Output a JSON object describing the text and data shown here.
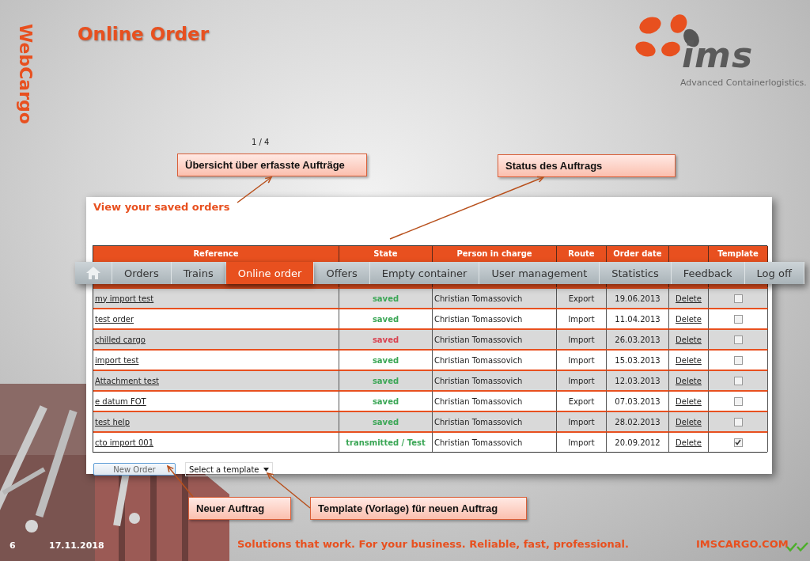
{
  "slide": {
    "side_title": "WebCargo",
    "title": "Online Order",
    "logo": {
      "wordmark": "ims",
      "tagline": "Advanced Containerlogistics."
    },
    "page_indicator": "1 / 4"
  },
  "callouts": [
    {
      "text": "Übersicht über erfasste Aufträge"
    },
    {
      "text": "Status des Auftrags"
    },
    {
      "text": "Neuer Auftrag"
    },
    {
      "text": "Template (Vorlage) für neuen Auftrag"
    }
  ],
  "panel": {
    "heading": "View your saved orders",
    "columns": [
      {
        "label": "Reference"
      },
      {
        "label": "State"
      },
      {
        "label": "Person in charge"
      },
      {
        "label": "Route"
      },
      {
        "label": "Order date"
      },
      {},
      {
        "label": "Template"
      }
    ],
    "rows": [
      {
        "reference": "my import test",
        "state": "saved",
        "color": "#3aa655",
        "person": "Christian Tomassovich",
        "route": "Export",
        "order_date": "19.06.2013",
        "action": "Delete",
        "template_checked": false
      },
      {
        "reference": "test order",
        "state": "saved",
        "color": "#3aa655",
        "person": "Christian Tomassovich",
        "route": "Import",
        "order_date": "11.04.2013",
        "action": "Delete",
        "template_checked": false
      },
      {
        "reference": "chilled cargo",
        "state": "saved",
        "color": "#d9414f",
        "person": "Christian Tomassovich",
        "route": "Import",
        "order_date": "26.03.2013",
        "action": "Delete",
        "template_checked": false
      },
      {
        "reference": "import test",
        "state": "saved",
        "color": "#3aa655",
        "person": "Christian Tomassovich",
        "route": "Import",
        "order_date": "15.03.2013",
        "action": "Delete",
        "template_checked": false
      },
      {
        "reference": "Attachment test",
        "state": "saved",
        "color": "#3aa655",
        "person": "Christian Tomassovich",
        "route": "Import",
        "order_date": "12.03.2013",
        "action": "Delete",
        "template_checked": false
      },
      {
        "reference": "e datum FOT",
        "state": "saved",
        "color": "#3aa655",
        "person": "Christian Tomassovich",
        "route": "Export",
        "order_date": "07.03.2013",
        "action": "Delete",
        "template_checked": false
      },
      {
        "reference": "test help",
        "state": "saved",
        "color": "#3aa655",
        "person": "Christian Tomassovich",
        "route": "Import",
        "order_date": "28.02.2013",
        "action": "Delete",
        "template_checked": false
      },
      {
        "reference": "cto import 001",
        "state": "transmitted / Test",
        "color": "#3aa655",
        "person": "Christian Tomassovich",
        "route": "Import",
        "order_date": "20.09.2012",
        "action": "Delete",
        "template_checked": true
      }
    ],
    "new_order_button": "New Order",
    "template_select": {
      "value": "Select a template"
    }
  },
  "nav": {
    "items": [
      {
        "kind": "home",
        "selected": false
      },
      {
        "kind": "text",
        "label": "Orders",
        "selected": false
      },
      {
        "kind": "text",
        "label": "Trains",
        "selected": false
      },
      {
        "kind": "text",
        "label": "Online order",
        "selected": true
      },
      {
        "kind": "text",
        "label": "Offers",
        "selected": false
      },
      {
        "kind": "text",
        "label": "Empty container",
        "selected": false
      },
      {
        "kind": "text",
        "label": "User management",
        "selected": false
      },
      {
        "kind": "text",
        "label": "Statistics",
        "selected": false
      },
      {
        "kind": "text",
        "label": "Feedback",
        "selected": false
      },
      {
        "kind": "text",
        "label": "Log off",
        "selected": false
      }
    ]
  },
  "footer": {
    "page_number": "6",
    "date": "17.11.2018",
    "slogan": "Solutions that work. For your business. Reliable, fast, professional.",
    "website": "IMSCARGO.COM"
  }
}
